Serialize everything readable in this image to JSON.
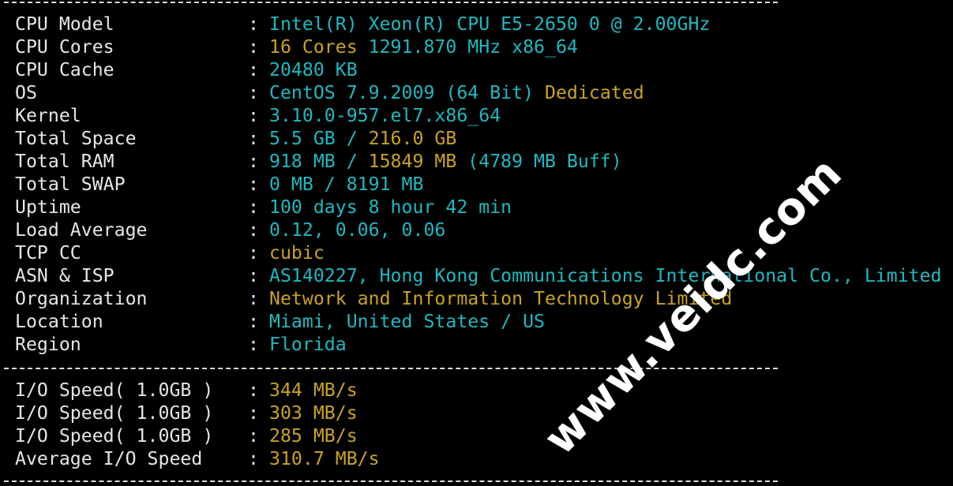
{
  "system_info": [
    {
      "label": "CPU Model",
      "parts": [
        {
          "text": "Intel(R) Xeon(R) CPU E5-2650 0 @ 2.00GHz",
          "color": "cyan"
        }
      ]
    },
    {
      "label": "CPU Cores",
      "parts": [
        {
          "text": "16 Cores ",
          "color": "yellow"
        },
        {
          "text": "1291.870 MHz x86_64",
          "color": "cyan"
        }
      ]
    },
    {
      "label": "CPU Cache",
      "parts": [
        {
          "text": "20480 KB",
          "color": "cyan"
        }
      ]
    },
    {
      "label": "OS",
      "parts": [
        {
          "text": "CentOS 7.9.2009 (64 Bit) ",
          "color": "cyan"
        },
        {
          "text": "Dedicated",
          "color": "yellow"
        }
      ]
    },
    {
      "label": "Kernel",
      "parts": [
        {
          "text": "3.10.0-957.el7.x86_64",
          "color": "cyan"
        }
      ]
    },
    {
      "label": "Total Space",
      "parts": [
        {
          "text": "5.5 GB / ",
          "color": "cyan"
        },
        {
          "text": "216.0 GB",
          "color": "yellow"
        }
      ]
    },
    {
      "label": "Total RAM",
      "parts": [
        {
          "text": "918 MB / ",
          "color": "cyan"
        },
        {
          "text": "15849 MB ",
          "color": "yellow"
        },
        {
          "text": "(4789 MB Buff)",
          "color": "cyan"
        }
      ]
    },
    {
      "label": "Total SWAP",
      "parts": [
        {
          "text": "0 MB / 8191 MB",
          "color": "cyan"
        }
      ]
    },
    {
      "label": "Uptime",
      "parts": [
        {
          "text": "100 days 8 hour 42 min",
          "color": "cyan"
        }
      ]
    },
    {
      "label": "Load Average",
      "parts": [
        {
          "text": "0.12, 0.06, 0.06",
          "color": "cyan"
        }
      ]
    },
    {
      "label": "TCP CC",
      "parts": [
        {
          "text": "cubic",
          "color": "yellow"
        }
      ]
    },
    {
      "label": "ASN & ISP",
      "parts": [
        {
          "text": "AS140227, Hong Kong Communications International Co., Limited",
          "color": "cyan"
        }
      ]
    },
    {
      "label": "Organization",
      "parts": [
        {
          "text": "Network and Information Technology Limited",
          "color": "yellow"
        }
      ]
    },
    {
      "label": "Location",
      "parts": [
        {
          "text": "Miami, United States / US",
          "color": "cyan"
        }
      ]
    },
    {
      "label": "Region",
      "parts": [
        {
          "text": "Florida",
          "color": "cyan"
        }
      ]
    }
  ],
  "io_info": [
    {
      "label": "I/O Speed( 1.0GB )",
      "parts": [
        {
          "text": "344 MB/s",
          "color": "yellow"
        }
      ]
    },
    {
      "label": "I/O Speed( 1.0GB )",
      "parts": [
        {
          "text": "303 MB/s",
          "color": "yellow"
        }
      ]
    },
    {
      "label": "I/O Speed( 1.0GB )",
      "parts": [
        {
          "text": "285 MB/s",
          "color": "yellow"
        }
      ]
    },
    {
      "label": "Average I/O Speed",
      "parts": [
        {
          "text": "310.7 MB/s",
          "color": "yellow"
        }
      ]
    }
  ],
  "separator_char": ":",
  "watermark": "www.veidc.com",
  "colors": {
    "background": "#000000",
    "label": "#e6e6e6",
    "cyan": "#20b8c0",
    "yellow": "#c9a227"
  }
}
